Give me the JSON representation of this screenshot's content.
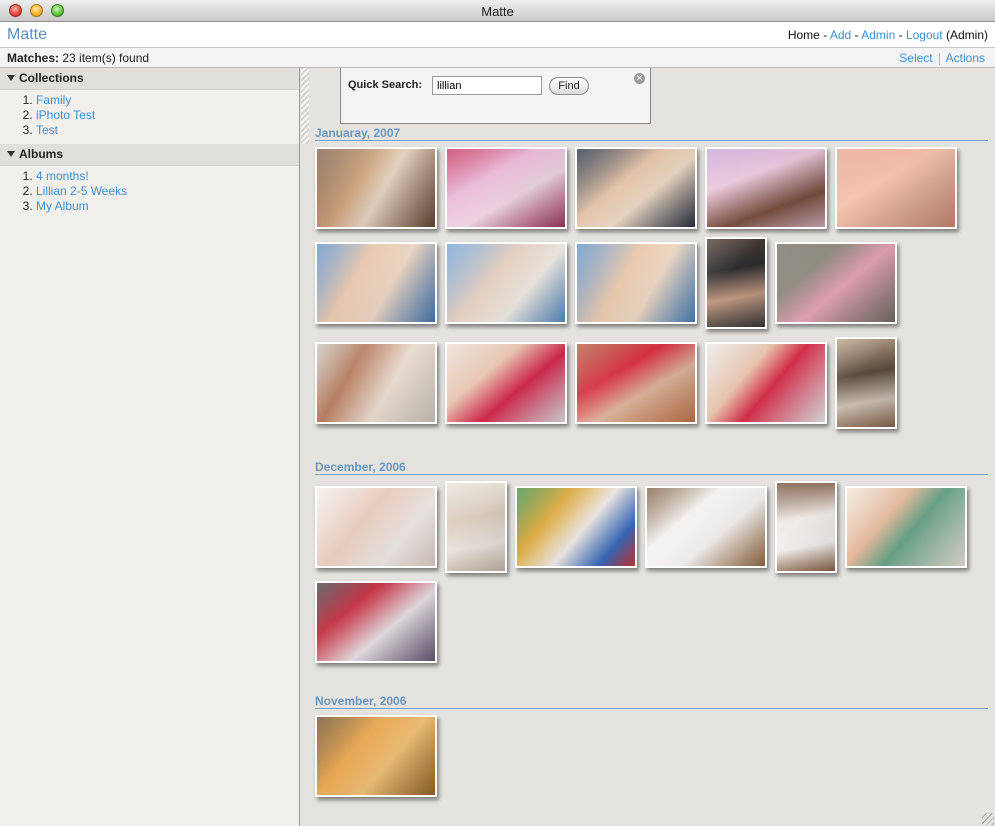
{
  "window": {
    "title": "Matte"
  },
  "header": {
    "app_name": "Matte",
    "nav": {
      "home": "Home",
      "add": "Add",
      "admin": "Admin",
      "logout": "Logout",
      "role": "(Admin)",
      "separator": "-"
    }
  },
  "status": {
    "matches_label": "Matches:",
    "matches_text": "23 item(s) found",
    "select": "Select",
    "actions": "Actions"
  },
  "sidebar": {
    "collections": {
      "title": "Collections",
      "items": [
        "Family",
        "iPhoto Test",
        "Test"
      ]
    },
    "albums": {
      "title": "Albums",
      "items": [
        "4 months!",
        "Lillian 2-5 Weeks",
        "My Album"
      ]
    }
  },
  "search": {
    "label": "Quick Search:",
    "value": "lillian",
    "button": "Find"
  },
  "groups": [
    {
      "title": "Januaray, 2007",
      "photo_count": 15
    },
    {
      "title": "December, 2006",
      "photo_count": 7
    },
    {
      "title": "November, 2006",
      "photo_count": 1
    }
  ],
  "colors": {
    "link": "#3e8fcf",
    "group_title": "#6a97bf",
    "app_name": "#5d8fc2"
  }
}
